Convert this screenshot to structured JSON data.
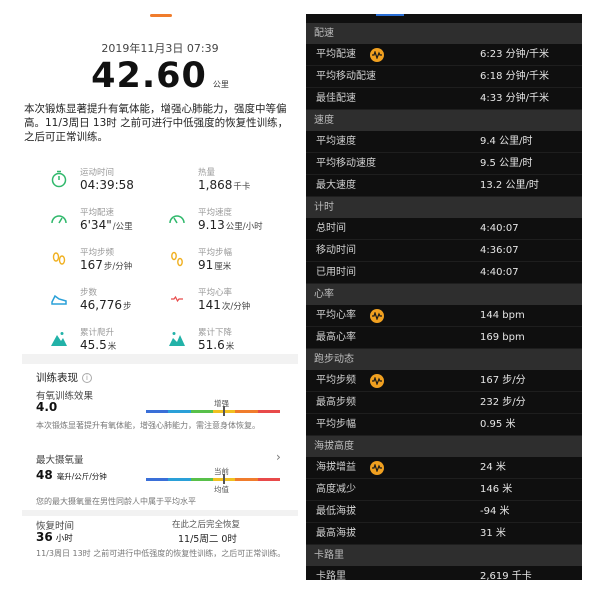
{
  "left": {
    "date": "2019年11月3日 07:39",
    "distance": "42.60",
    "distance_unit": "公里",
    "summary": "本次锻炼显著提升有氧体能，增强心肺能力，强度中等偏高。11/3周日 13时 之前可进行中低强度的恢复性训练，之后可正常训练。",
    "stats": [
      {
        "label": "运动时间",
        "value": "04:39:58",
        "unit": "",
        "icon": "stopwatch-icon",
        "color": "#2fb86b"
      },
      {
        "label": "热量",
        "value": "1,868",
        "unit": "千卡",
        "icon": "flame-icon",
        "color": "#f07c2c"
      },
      {
        "label": "平均配速",
        "value": "6'34\"",
        "unit": "/公里",
        "icon": "speedometer-icon",
        "color": "#2fb86b"
      },
      {
        "label": "平均速度",
        "value": "9.13",
        "unit": "公里/小时",
        "icon": "speed-gauge-icon",
        "color": "#2fb86b"
      },
      {
        "label": "平均步频",
        "value": "167",
        "unit": "步/分钟",
        "icon": "footprints-icon",
        "color": "#f0b020"
      },
      {
        "label": "平均步幅",
        "value": "91",
        "unit": "厘米",
        "icon": "stride-icon",
        "color": "#f0b020"
      },
      {
        "label": "步数",
        "value": "46,776",
        "unit": "步",
        "icon": "shoe-icon",
        "color": "#2aa0d8"
      },
      {
        "label": "平均心率",
        "value": "141",
        "unit": "次/分钟",
        "icon": "heart-rate-icon",
        "color": "#e84a4a"
      },
      {
        "label": "累计爬升",
        "value": "45.5",
        "unit": "米",
        "icon": "climb-icon",
        "color": "#22b2a8"
      },
      {
        "label": "累计下降",
        "value": "51.6",
        "unit": "米",
        "icon": "descent-icon",
        "color": "#22b2a8"
      }
    ],
    "training": {
      "title": "训练表现",
      "aerobic_label": "有氧训练效果",
      "aerobic_value": "4.0",
      "aerobic_marker": "增强",
      "aerobic_desc": "本次锻炼显著提升有氧体能，增强心肺能力，需注意身体恢复。",
      "vo2_label": "最大摄氧量",
      "vo2_value": "48",
      "vo2_unit": "毫升/公斤/分钟",
      "vo2_marker_top": "当前",
      "vo2_marker_bottom": "均值",
      "vo2_desc": "您的最大摄氧量在男性同龄人中属于平均水平",
      "recovery_label": "恢复时间",
      "recovery_value": "36",
      "recovery_unit": "小时",
      "recovery_after_label": "在此之后完全恢复",
      "recovery_after_value": "11/5周二 0时",
      "recovery_desc": "11/3周日 13时 之前可进行中低强度的恢复性训练，之后可正常训练。"
    }
  },
  "right": {
    "sections": [
      {
        "title": "配速",
        "rows": [
          {
            "k": "平均配速",
            "v": "6:23 分钟/千米",
            "wave": true
          },
          {
            "k": "平均移动配速",
            "v": "6:18 分钟/千米",
            "wave": false
          },
          {
            "k": "最佳配速",
            "v": "4:33 分钟/千米",
            "wave": false
          }
        ]
      },
      {
        "title": "速度",
        "rows": [
          {
            "k": "平均速度",
            "v": "9.4 公里/时",
            "wave": false
          },
          {
            "k": "平均移动速度",
            "v": "9.5 公里/时",
            "wave": false
          },
          {
            "k": "最大速度",
            "v": "13.2 公里/时",
            "wave": false
          }
        ]
      },
      {
        "title": "计时",
        "rows": [
          {
            "k": "总时间",
            "v": "4:40:07",
            "wave": false
          },
          {
            "k": "移动时间",
            "v": "4:36:07",
            "wave": false
          },
          {
            "k": "已用时间",
            "v": "4:40:07",
            "wave": false
          }
        ]
      },
      {
        "title": "心率",
        "rows": [
          {
            "k": "平均心率",
            "v": "144 bpm",
            "wave": true
          },
          {
            "k": "最高心率",
            "v": "169 bpm",
            "wave": false
          }
        ]
      },
      {
        "title": "跑步动态",
        "rows": [
          {
            "k": "平均步频",
            "v": "167 步/分",
            "wave": true
          },
          {
            "k": "最高步频",
            "v": "232 步/分",
            "wave": false
          },
          {
            "k": "平均步幅",
            "v": "0.95 米",
            "wave": false
          }
        ]
      },
      {
        "title": "海拔高度",
        "rows": [
          {
            "k": "海拔增益",
            "v": "24 米",
            "wave": true
          },
          {
            "k": "高度减少",
            "v": "146 米",
            "wave": false
          },
          {
            "k": "最低海拔",
            "v": "-94 米",
            "wave": false
          },
          {
            "k": "最高海拔",
            "v": "31 米",
            "wave": false
          }
        ]
      },
      {
        "title": "卡路里",
        "rows": [
          {
            "k": "卡路里",
            "v": "2,619 千卡",
            "wave": false
          },
          {
            "k": "卡路里",
            "v": "",
            "wave": false
          }
        ]
      }
    ]
  }
}
